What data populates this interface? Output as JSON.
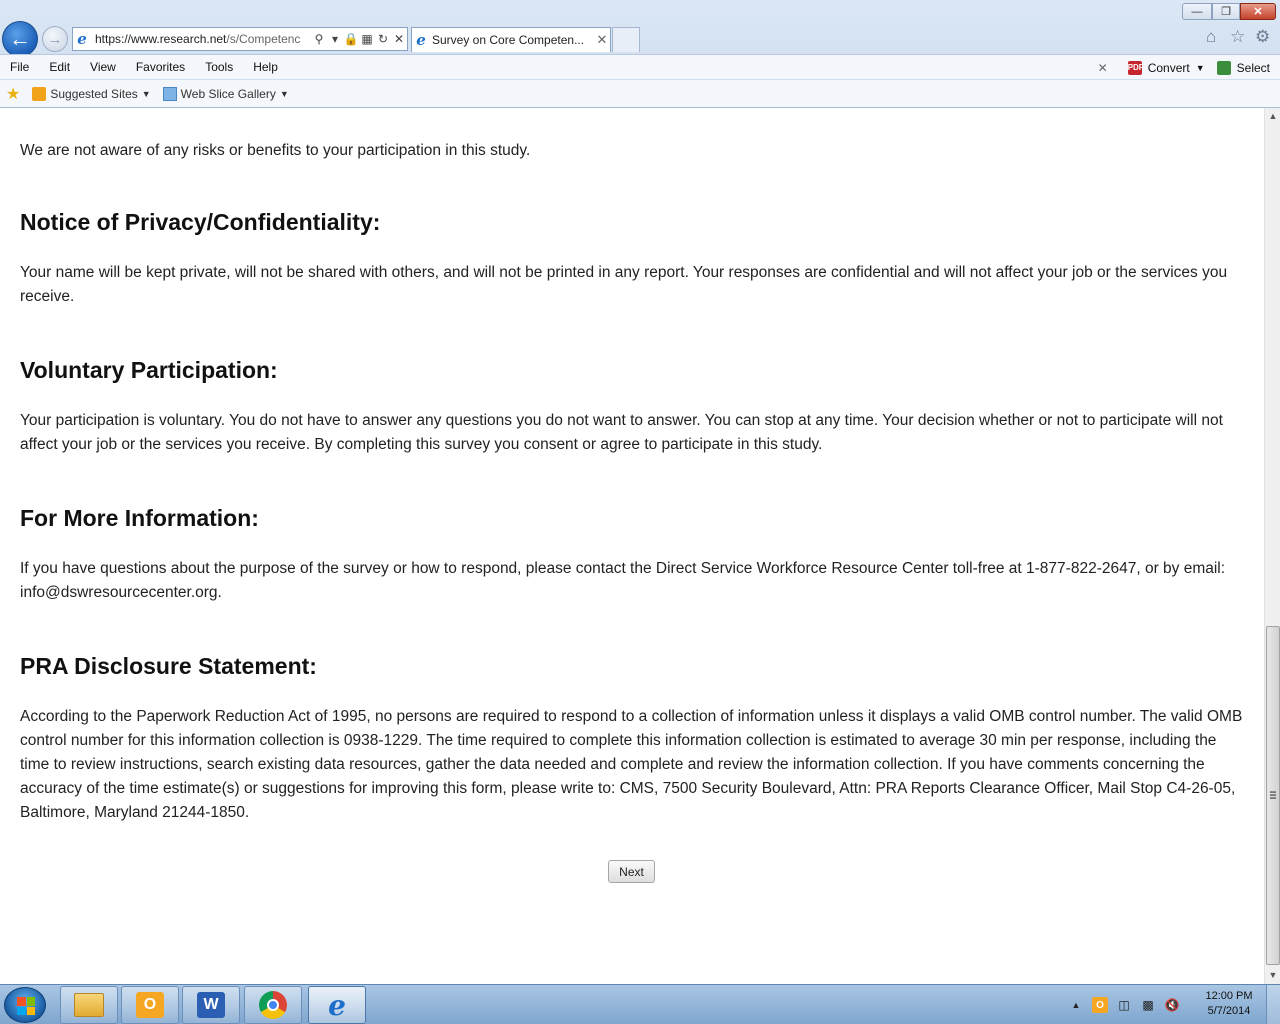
{
  "browser": {
    "address_url_main": "https://www.research.net",
    "address_url_rest": "/s/Competenc",
    "tab_title": "Survey on Core Competen...",
    "menu": [
      "File",
      "Edit",
      "View",
      "Favorites",
      "Tools",
      "Help"
    ],
    "toolbar_right": {
      "convert_label": "Convert",
      "select_label": "Select"
    },
    "favorites": [
      {
        "label": "Suggested Sites"
      },
      {
        "label": "Web Slice Gallery"
      }
    ]
  },
  "content": {
    "intro_text": "We are not aware of any risks or benefits to your participation in this study.",
    "sections": [
      {
        "heading": "Notice of Privacy/Confidentiality:",
        "body": "Your name will be kept private, will not be shared with others, and will not be printed in any report. Your responses are confidential and will not affect your job or the services you receive."
      },
      {
        "heading": "Voluntary Participation:",
        "body": "Your participation is voluntary. You do not have to answer any questions you do not want to answer. You can stop at any time. Your decision whether or not to participate will not affect your job or the services you receive. By completing this survey you consent or agree to participate in this study."
      },
      {
        "heading": "For More Information:",
        "body": "If you have questions about the purpose of the survey or how to respond, please contact the Direct Service Workforce Resource Center toll-free at 1-877-822-2647, or by email: info@dswresourcecenter.org."
      },
      {
        "heading": "PRA Disclosure Statement:",
        "body": "According to the Paperwork Reduction Act of 1995, no persons are required to respond to a collection of information unless it displays a valid OMB control number. The valid OMB control number for this information collection is 0938-1229. The time required to complete this information collection is estimated to average 30 min per response, including the time to review instructions, search existing data resources, gather the data needed and complete and review the information collection. If you have comments concerning the accuracy of the time estimate(s) or suggestions for improving this form, please write to: CMS, 7500 Security Boulevard, Attn: PRA Reports Clearance Officer, Mail Stop C4-26-05, Baltimore, Maryland 21244-1850."
      }
    ],
    "next_label": "Next"
  },
  "taskbar": {
    "clock_time": "12:00 PM",
    "clock_date": "5/7/2014"
  },
  "colors": {
    "ie_blue": "#1e6fc9",
    "close_red": "#c4432b",
    "taskbar_blue": "#7fa6cf"
  }
}
